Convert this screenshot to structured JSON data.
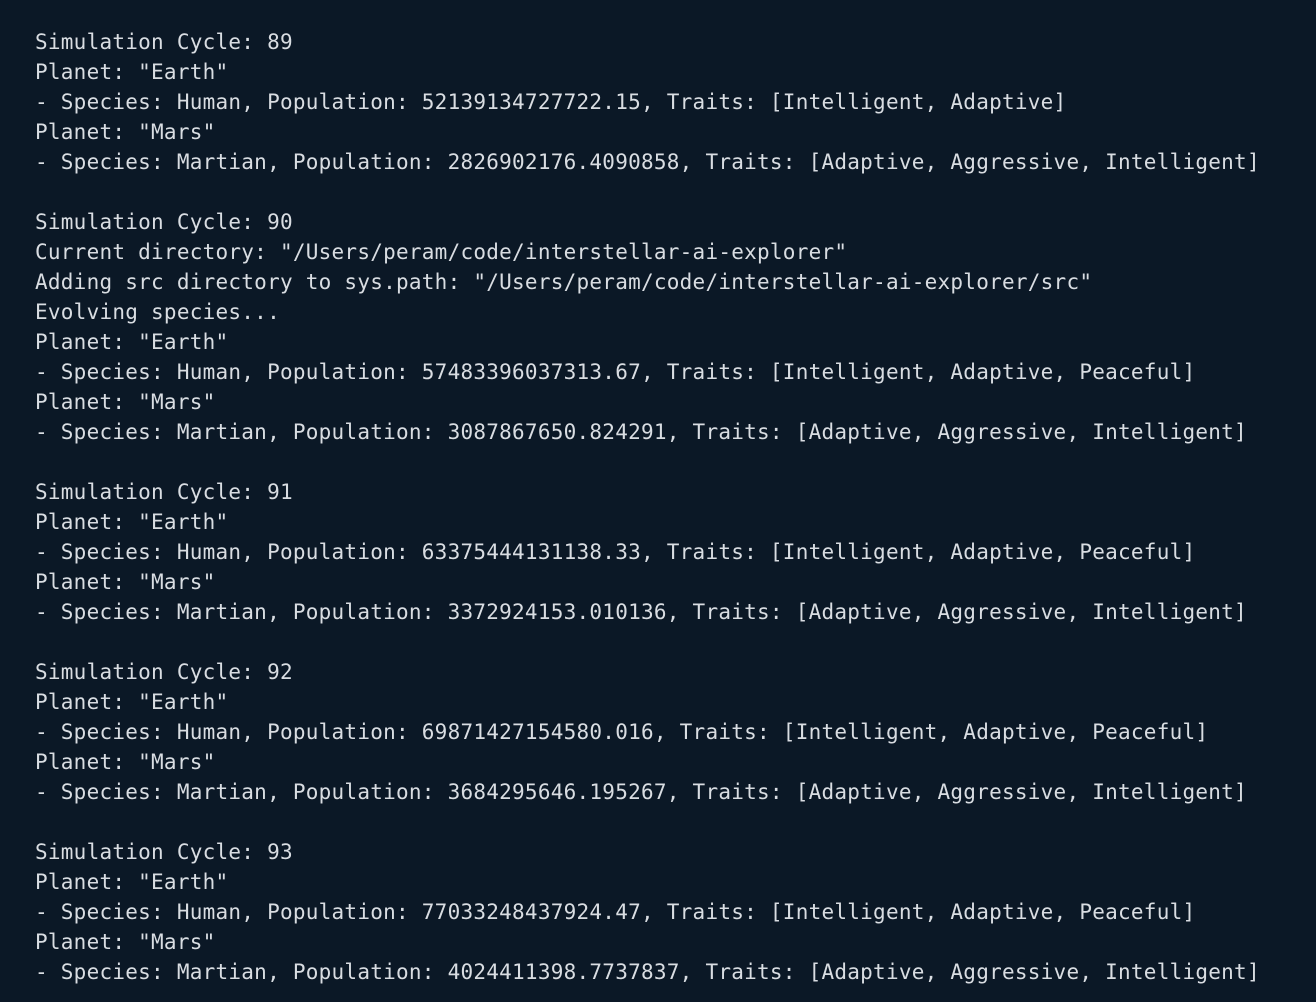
{
  "terminal": {
    "lines": [
      "Simulation Cycle: 89",
      "Planet: \"Earth\"",
      "- Species: Human, Population: 52139134727722.15, Traits: [Intelligent, Adaptive]",
      "Planet: \"Mars\"",
      "- Species: Martian, Population: 2826902176.4090858, Traits: [Adaptive, Aggressive, Intelligent]",
      "",
      "Simulation Cycle: 90",
      "Current directory: \"/Users/peram/code/interstellar-ai-explorer\"",
      "Adding src directory to sys.path: \"/Users/peram/code/interstellar-ai-explorer/src\"",
      "Evolving species...",
      "Planet: \"Earth\"",
      "- Species: Human, Population: 57483396037313.67, Traits: [Intelligent, Adaptive, Peaceful]",
      "Planet: \"Mars\"",
      "- Species: Martian, Population: 3087867650.824291, Traits: [Adaptive, Aggressive, Intelligent]",
      "",
      "Simulation Cycle: 91",
      "Planet: \"Earth\"",
      "- Species: Human, Population: 63375444131138.33, Traits: [Intelligent, Adaptive, Peaceful]",
      "Planet: \"Mars\"",
      "- Species: Martian, Population: 3372924153.010136, Traits: [Adaptive, Aggressive, Intelligent]",
      "",
      "Simulation Cycle: 92",
      "Planet: \"Earth\"",
      "- Species: Human, Population: 69871427154580.016, Traits: [Intelligent, Adaptive, Peaceful]",
      "Planet: \"Mars\"",
      "- Species: Martian, Population: 3684295646.195267, Traits: [Adaptive, Aggressive, Intelligent]",
      "",
      "Simulation Cycle: 93",
      "Planet: \"Earth\"",
      "- Species: Human, Population: 77033248437924.47, Traits: [Intelligent, Adaptive, Peaceful]",
      "Planet: \"Mars\"",
      "- Species: Martian, Population: 4024411398.7737837, Traits: [Adaptive, Aggressive, Intelligent]"
    ]
  },
  "colors": {
    "background": "#0b1826",
    "text": "#d9dde2"
  }
}
